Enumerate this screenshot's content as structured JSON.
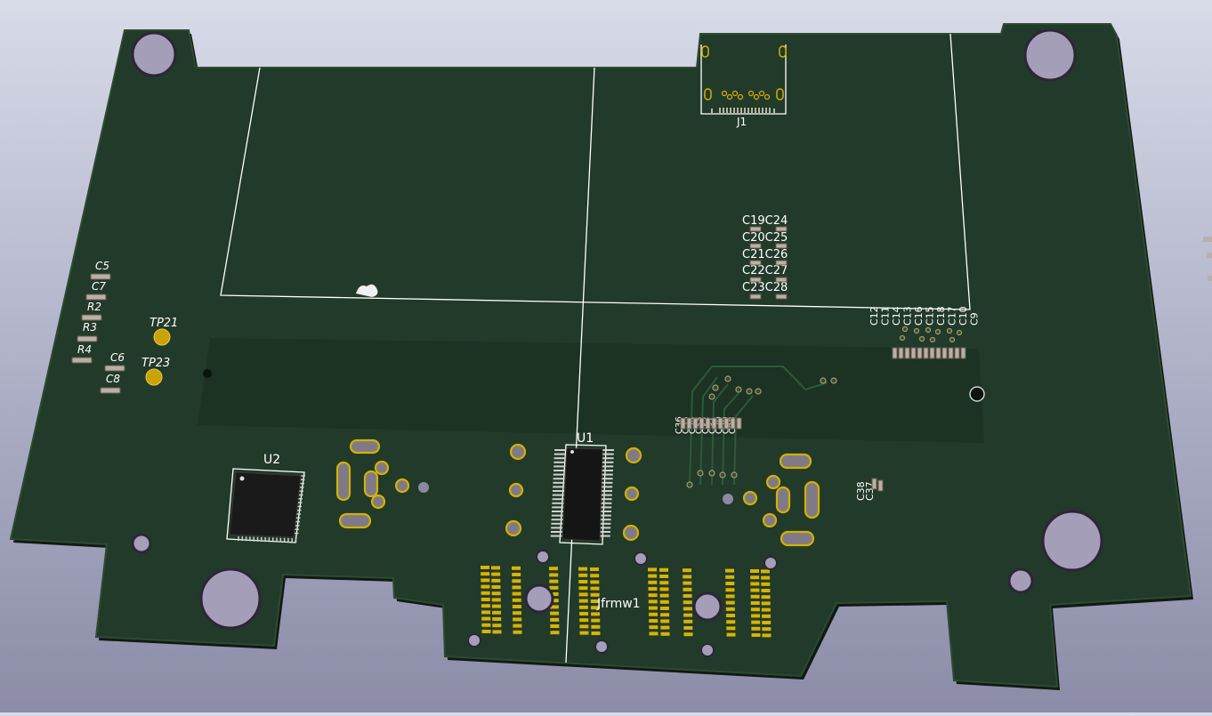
{
  "viewer": {
    "title": "",
    "background_top": "#d8dbe8",
    "background_bottom": "#8c8ca8"
  },
  "board": {
    "solder_mask_color": "#223a29",
    "pad_color": "#c9a400",
    "silkscreen_color": "#ffffff"
  },
  "labels": {
    "j1": "J1",
    "u1": "U1",
    "u2": "U2",
    "jfrmw1": "Jfrmw1",
    "tp21": "TP21",
    "tp23": "TP23",
    "c5": "C5",
    "c7": "C7",
    "r2": "R2",
    "r3": "R3",
    "r4": "R4",
    "c6": "C6",
    "c8": "C8",
    "c19c24": "C19C24",
    "c20c25": "C20C25",
    "c21c26": "C21C26",
    "c22c27": "C22C27",
    "c23c28": "C23C28",
    "cap_column_row": [
      "C12",
      "C11",
      "C14",
      "C13",
      "C16",
      "C15",
      "C18",
      "C17",
      "C10",
      "C9"
    ],
    "cap_mid_row": [
      "C36",
      "C35",
      "C34",
      "C33",
      "C32",
      "C31",
      "C30",
      "C29",
      "C28"
    ],
    "c38": "C38",
    "c37": "C37"
  }
}
